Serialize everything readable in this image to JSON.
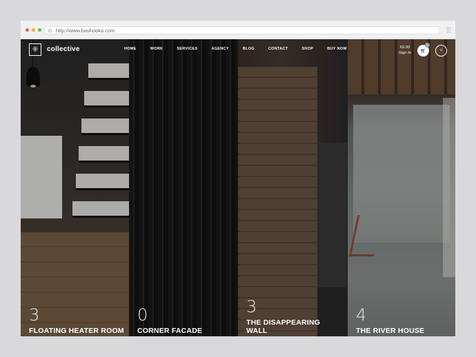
{
  "browser": {
    "url": "http://www.bashooka.com"
  },
  "header": {
    "logo_icon": "⁜",
    "logo_text": "collective",
    "nav": [
      "HOME",
      "WORK",
      "SERVICES",
      "AGENCY",
      "BLOG",
      "CONTACT",
      "SHOP",
      "BUY NOW"
    ],
    "cart_total": "€0.00",
    "sign_in": "Sign In",
    "cart_count": "0"
  },
  "projects": [
    {
      "number": "3",
      "title": "FLOATING HEATER ROOM"
    },
    {
      "number": "0",
      "title": "CORNER FACADE"
    },
    {
      "number": "3",
      "title": "THE DISAPPEARING WALL"
    },
    {
      "number": "4",
      "title": "THE RIVER HOUSE"
    }
  ]
}
